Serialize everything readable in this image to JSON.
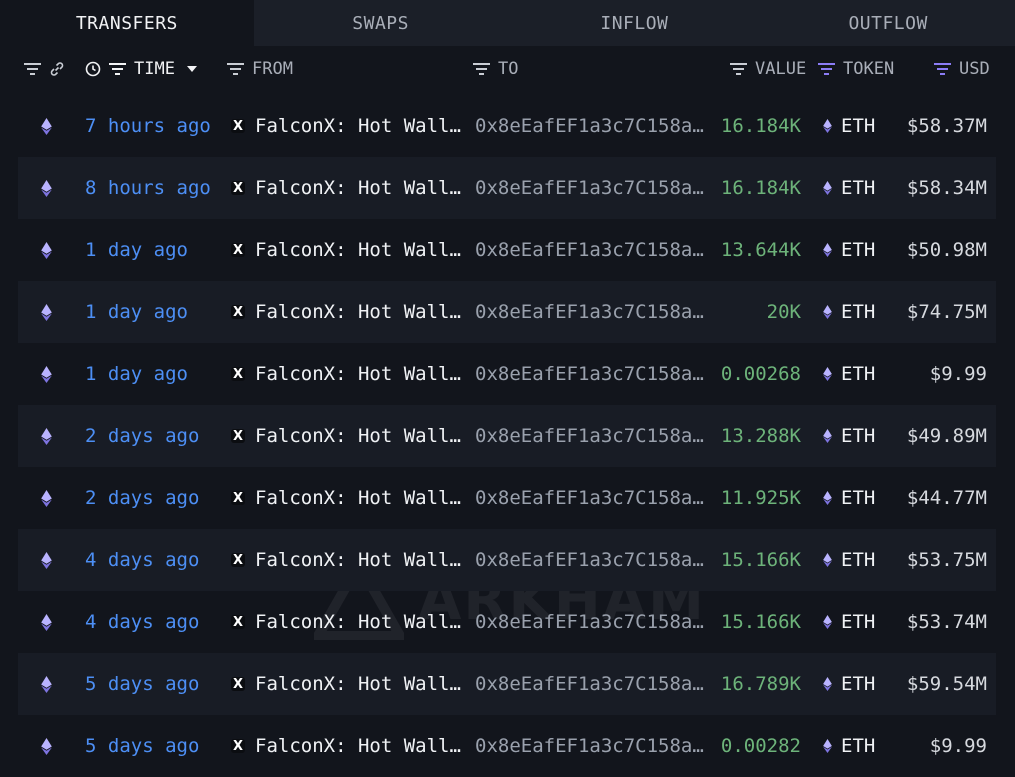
{
  "tabs": [
    {
      "label": "TRANSFERS",
      "active": true
    },
    {
      "label": "SWAPS",
      "active": false
    },
    {
      "label": "INFLOW",
      "active": false
    },
    {
      "label": "OUTFLOW",
      "active": false
    }
  ],
  "header": {
    "time": "TIME",
    "from": "FROM",
    "to": "TO",
    "value": "VALUE",
    "token": "TOKEN",
    "usd": "USD"
  },
  "icons": {
    "filter": "filter-icon",
    "link": "link-icon",
    "clock": "clock-icon",
    "sort": "caret-down-icon",
    "chain": "ethereum-icon",
    "entity": "falconx-logo-icon"
  },
  "colors": {
    "time_link": "#4d8ff5",
    "value_positive": "#6db37a",
    "purple_filter": "#8b7cf6"
  },
  "rows": [
    {
      "time": "7 hours ago",
      "from": "FalconX: Hot Wall…",
      "to": "0x8eEafEF1a3c7C158a…",
      "value": "16.184K",
      "token": "ETH",
      "usd": "$58.37M"
    },
    {
      "time": "8 hours ago",
      "from": "FalconX: Hot Wall…",
      "to": "0x8eEafEF1a3c7C158a…",
      "value": "16.184K",
      "token": "ETH",
      "usd": "$58.34M"
    },
    {
      "time": "1 day ago",
      "from": "FalconX: Hot Wall…",
      "to": "0x8eEafEF1a3c7C158a…",
      "value": "13.644K",
      "token": "ETH",
      "usd": "$50.98M"
    },
    {
      "time": "1 day ago",
      "from": "FalconX: Hot Wall…",
      "to": "0x8eEafEF1a3c7C158a…",
      "value": "20K",
      "token": "ETH",
      "usd": "$74.75M"
    },
    {
      "time": "1 day ago",
      "from": "FalconX: Hot Wall…",
      "to": "0x8eEafEF1a3c7C158a…",
      "value": "0.00268",
      "token": "ETH",
      "usd": "$9.99"
    },
    {
      "time": "2 days ago",
      "from": "FalconX: Hot Wall…",
      "to": "0x8eEafEF1a3c7C158a…",
      "value": "13.288K",
      "token": "ETH",
      "usd": "$49.89M"
    },
    {
      "time": "2 days ago",
      "from": "FalconX: Hot Wall…",
      "to": "0x8eEafEF1a3c7C158a…",
      "value": "11.925K",
      "token": "ETH",
      "usd": "$44.77M"
    },
    {
      "time": "4 days ago",
      "from": "FalconX: Hot Wall…",
      "to": "0x8eEafEF1a3c7C158a…",
      "value": "15.166K",
      "token": "ETH",
      "usd": "$53.75M"
    },
    {
      "time": "4 days ago",
      "from": "FalconX: Hot Wall…",
      "to": "0x8eEafEF1a3c7C158a…",
      "value": "15.166K",
      "token": "ETH",
      "usd": "$53.74M"
    },
    {
      "time": "5 days ago",
      "from": "FalconX: Hot Wall…",
      "to": "0x8eEafEF1a3c7C158a…",
      "value": "16.789K",
      "token": "ETH",
      "usd": "$59.54M"
    },
    {
      "time": "5 days ago",
      "from": "FalconX: Hot Wall…",
      "to": "0x8eEafEF1a3c7C158a…",
      "value": "0.00282",
      "token": "ETH",
      "usd": "$9.99"
    }
  ],
  "watermark": {
    "text": "ARKHAM"
  }
}
